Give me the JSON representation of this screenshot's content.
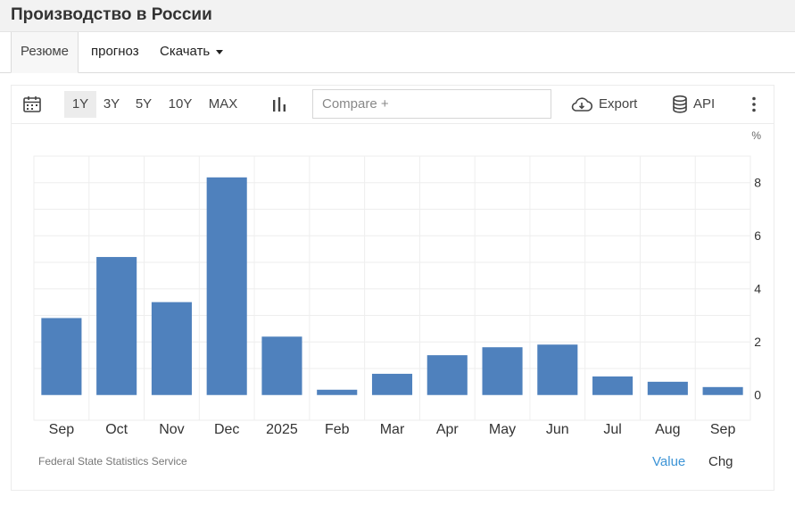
{
  "header": {
    "title": "Производство в России"
  },
  "tabs": [
    {
      "label": "Резюме"
    },
    {
      "label": "прогноз"
    },
    {
      "label": "Скачать"
    }
  ],
  "toolbar": {
    "ranges": [
      "1Y",
      "3Y",
      "5Y",
      "10Y",
      "MAX"
    ],
    "compare_placeholder": "Compare +",
    "export_label": "Export",
    "api_label": "API"
  },
  "footer": {
    "source": "Federal State Statistics Service",
    "value_label": "Value",
    "chg_label": "Chg"
  },
  "colors": {
    "bar": "#4f81bd",
    "accent": "#3d94d6",
    "grid": "#eeeeee"
  },
  "chart_data": {
    "type": "bar",
    "categories": [
      "Sep",
      "Oct",
      "Nov",
      "Dec",
      "2025",
      "Feb",
      "Mar",
      "Apr",
      "May",
      "Jun",
      "Jul",
      "Aug",
      "Sep"
    ],
    "values": [
      2.9,
      5.2,
      3.5,
      8.2,
      2.2,
      0.2,
      0.8,
      1.5,
      1.8,
      1.9,
      0.7,
      0.5,
      0.3
    ],
    "ylabel": "%",
    "yticks": [
      0,
      2,
      4,
      6,
      8
    ],
    "ylim": [
      -0.95,
      9.0
    ],
    "grid": true
  }
}
